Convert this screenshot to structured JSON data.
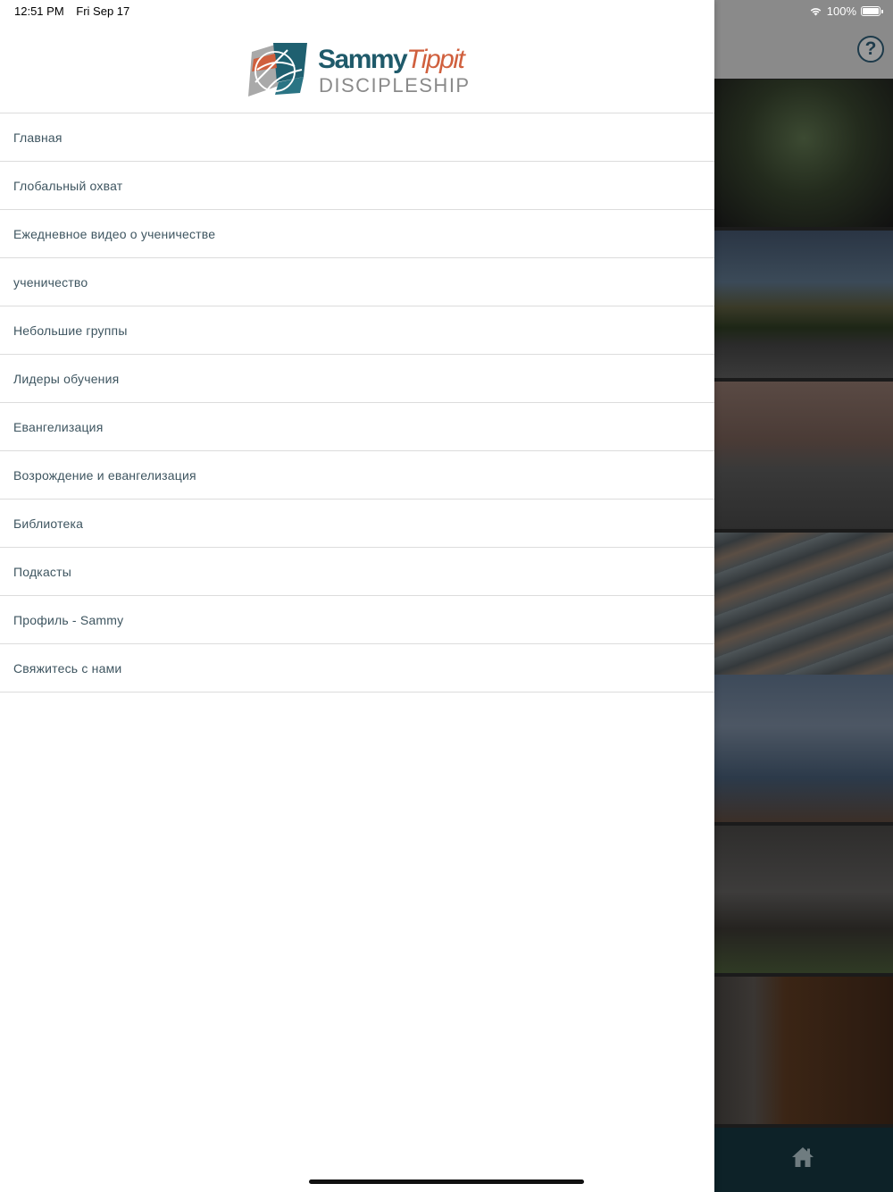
{
  "status_bar": {
    "time": "12:51 PM",
    "date": "Fri Sep 17",
    "battery_text": "100%",
    "battery_level": 1.0,
    "wifi_icon": "wifi-icon",
    "battery_icon": "battery-icon"
  },
  "logo": {
    "first_name": "Sammy",
    "last_name": "Tippit",
    "subtitle": "DISCIPLESHIP",
    "colors": {
      "teal": "#1f5a6a",
      "orange": "#d0603e",
      "gray": "#8a8a8a"
    }
  },
  "menu": {
    "items": [
      {
        "label": "Главная"
      },
      {
        "label": "Глобальный охват"
      },
      {
        "label": "Ежедневное видео о ученичестве"
      },
      {
        "label": "ученичество"
      },
      {
        "label": "Небольшие группы"
      },
      {
        "label": "Лидеры обучения"
      },
      {
        "label": "Евангелизация"
      },
      {
        "label": "Возрождение и евангелизация"
      },
      {
        "label": "Библиотека"
      },
      {
        "label": "Подкасты"
      },
      {
        "label": "Профиль - Sammy"
      },
      {
        "label": "Свяжитесь с нами"
      }
    ]
  },
  "background": {
    "help_icon": "question-mark-icon",
    "help_glyph": "?",
    "footer_icon": "home-icon",
    "footer_color": "#0d2228"
  }
}
